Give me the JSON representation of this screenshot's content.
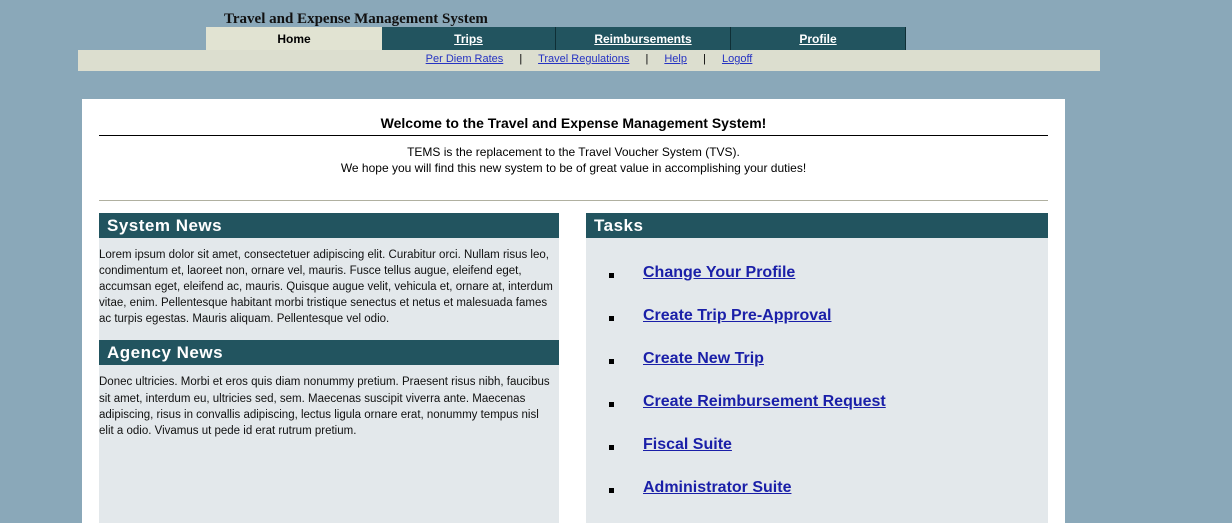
{
  "app": {
    "title": "Travel and Expense Management System"
  },
  "tabs": [
    {
      "label": "Home",
      "active": true
    },
    {
      "label": "Trips",
      "active": false
    },
    {
      "label": "Reimbursements",
      "active": false
    },
    {
      "label": "Profile",
      "active": false
    }
  ],
  "subnav": {
    "links": [
      "Per Diem Rates",
      "Travel Regulations",
      "Help",
      "Logoff"
    ],
    "separator": "|"
  },
  "welcome": {
    "heading": "Welcome to the Travel and Expense Management System!",
    "line1": "TEMS is the replacement to the Travel Voucher System (TVS).",
    "line2": "We hope you will find this new system to be of great value in accomplishing your duties!"
  },
  "system_news": {
    "title": "System News",
    "text": "Lorem ipsum dolor sit amet, consectetuer adipiscing elit. Curabitur orci. Nullam risus leo, condimentum et, laoreet non, ornare vel, mauris. Fusce tellus augue, eleifend eget, accumsan eget, eleifend ac, mauris. Quisque augue velit, vehicula et, ornare at, interdum vitae, enim. Pellentesque habitant morbi tristique senectus et netus et malesuada fames ac turpis egestas. Mauris aliquam. Pellentesque vel odio."
  },
  "agency_news": {
    "title": "Agency News",
    "text": "Donec ultricies. Morbi et eros quis diam nonummy pretium. Praesent risus nibh, faucibus sit amet, interdum eu, ultricies sed, sem. Maecenas suscipit viverra ante. Maecenas adipiscing, risus in convallis adipiscing, lectus ligula ornare erat, nonummy tempus nisl elit a odio. Vivamus ut pede id erat rutrum pretium."
  },
  "tasks": {
    "title": "Tasks",
    "items": [
      "Change Your Profile",
      "Create Trip Pre-Approval",
      "Create New Trip",
      "Create Reimbursement Request",
      "Fiscal Suite",
      "Administrator Suite"
    ]
  },
  "colors": {
    "background": "#8aa8b9",
    "header_teal": "#22545f",
    "active_tab": "#e1e3d2",
    "subnav_bg": "#dcdecf",
    "link_blue": "#1a1fa8",
    "column_bg": "#e3e8eb"
  }
}
